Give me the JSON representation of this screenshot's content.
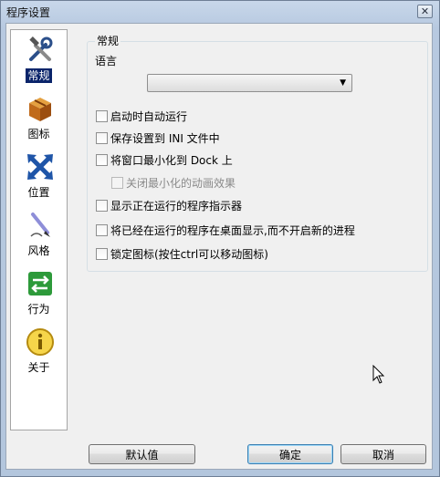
{
  "window": {
    "title": "程序设置",
    "close_glyph": "✕"
  },
  "sidebar": {
    "items": [
      {
        "label": "常规",
        "icon": "tools-icon",
        "selected": true
      },
      {
        "label": "图标",
        "icon": "box-icon"
      },
      {
        "label": "位置",
        "icon": "arrows-icon"
      },
      {
        "label": "风格",
        "icon": "pen-icon"
      },
      {
        "label": "行为",
        "icon": "exchange-icon"
      },
      {
        "label": "关于",
        "icon": "info-icon"
      }
    ]
  },
  "general": {
    "group_title": "常规",
    "language_label": "语言",
    "language_value": "",
    "options": [
      {
        "label": "启动时自动运行",
        "checked": false,
        "disabled": false
      },
      {
        "label": "保存设置到 INI 文件中",
        "checked": false,
        "disabled": false
      },
      {
        "label": "将窗口最小化到 Dock 上",
        "checked": false,
        "disabled": false
      },
      {
        "label": "关闭最小化的动画效果",
        "checked": false,
        "disabled": true
      },
      {
        "label": "显示正在运行的程序指示器",
        "checked": false,
        "disabled": false
      },
      {
        "label": "将已经在运行的程序在桌面显示,而不开启新的进程",
        "checked": false,
        "disabled": false
      },
      {
        "label": "锁定图标(按住ctrl可以移动图标)",
        "checked": false,
        "disabled": false
      }
    ]
  },
  "footer": {
    "defaults_label": "默认值",
    "ok_label": "确定",
    "cancel_label": "取消"
  },
  "colors": {
    "selection": "#0a246a",
    "titlebar": "#b9cbe1"
  }
}
